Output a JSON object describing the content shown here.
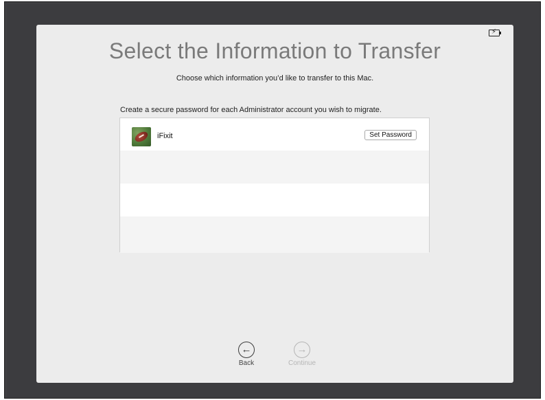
{
  "status_bar": {
    "battery_icon": "battery-charging-icon"
  },
  "header": {
    "title": "Select the Information to Transfer",
    "subtitle": "Choose which information you’d like to transfer to this Mac."
  },
  "main": {
    "instruction": "Create a secure password for each Administrator account you wish to migrate.",
    "accounts": [
      {
        "name": "iFixit",
        "avatar_icon": "football-avatar-icon",
        "action_label": "Set Password"
      }
    ]
  },
  "footer": {
    "back": {
      "icon": "left-arrow-circle-icon",
      "label": "Back",
      "glyph": "←"
    },
    "continue": {
      "icon": "right-arrow-circle-icon",
      "label": "Continue",
      "glyph": "→",
      "enabled": false
    }
  },
  "colors": {
    "window_background": "#ececec",
    "screen_background": "#3c3c3f",
    "title_gray": "#7a7a7a",
    "disabled_gray": "#b5b5b5"
  }
}
